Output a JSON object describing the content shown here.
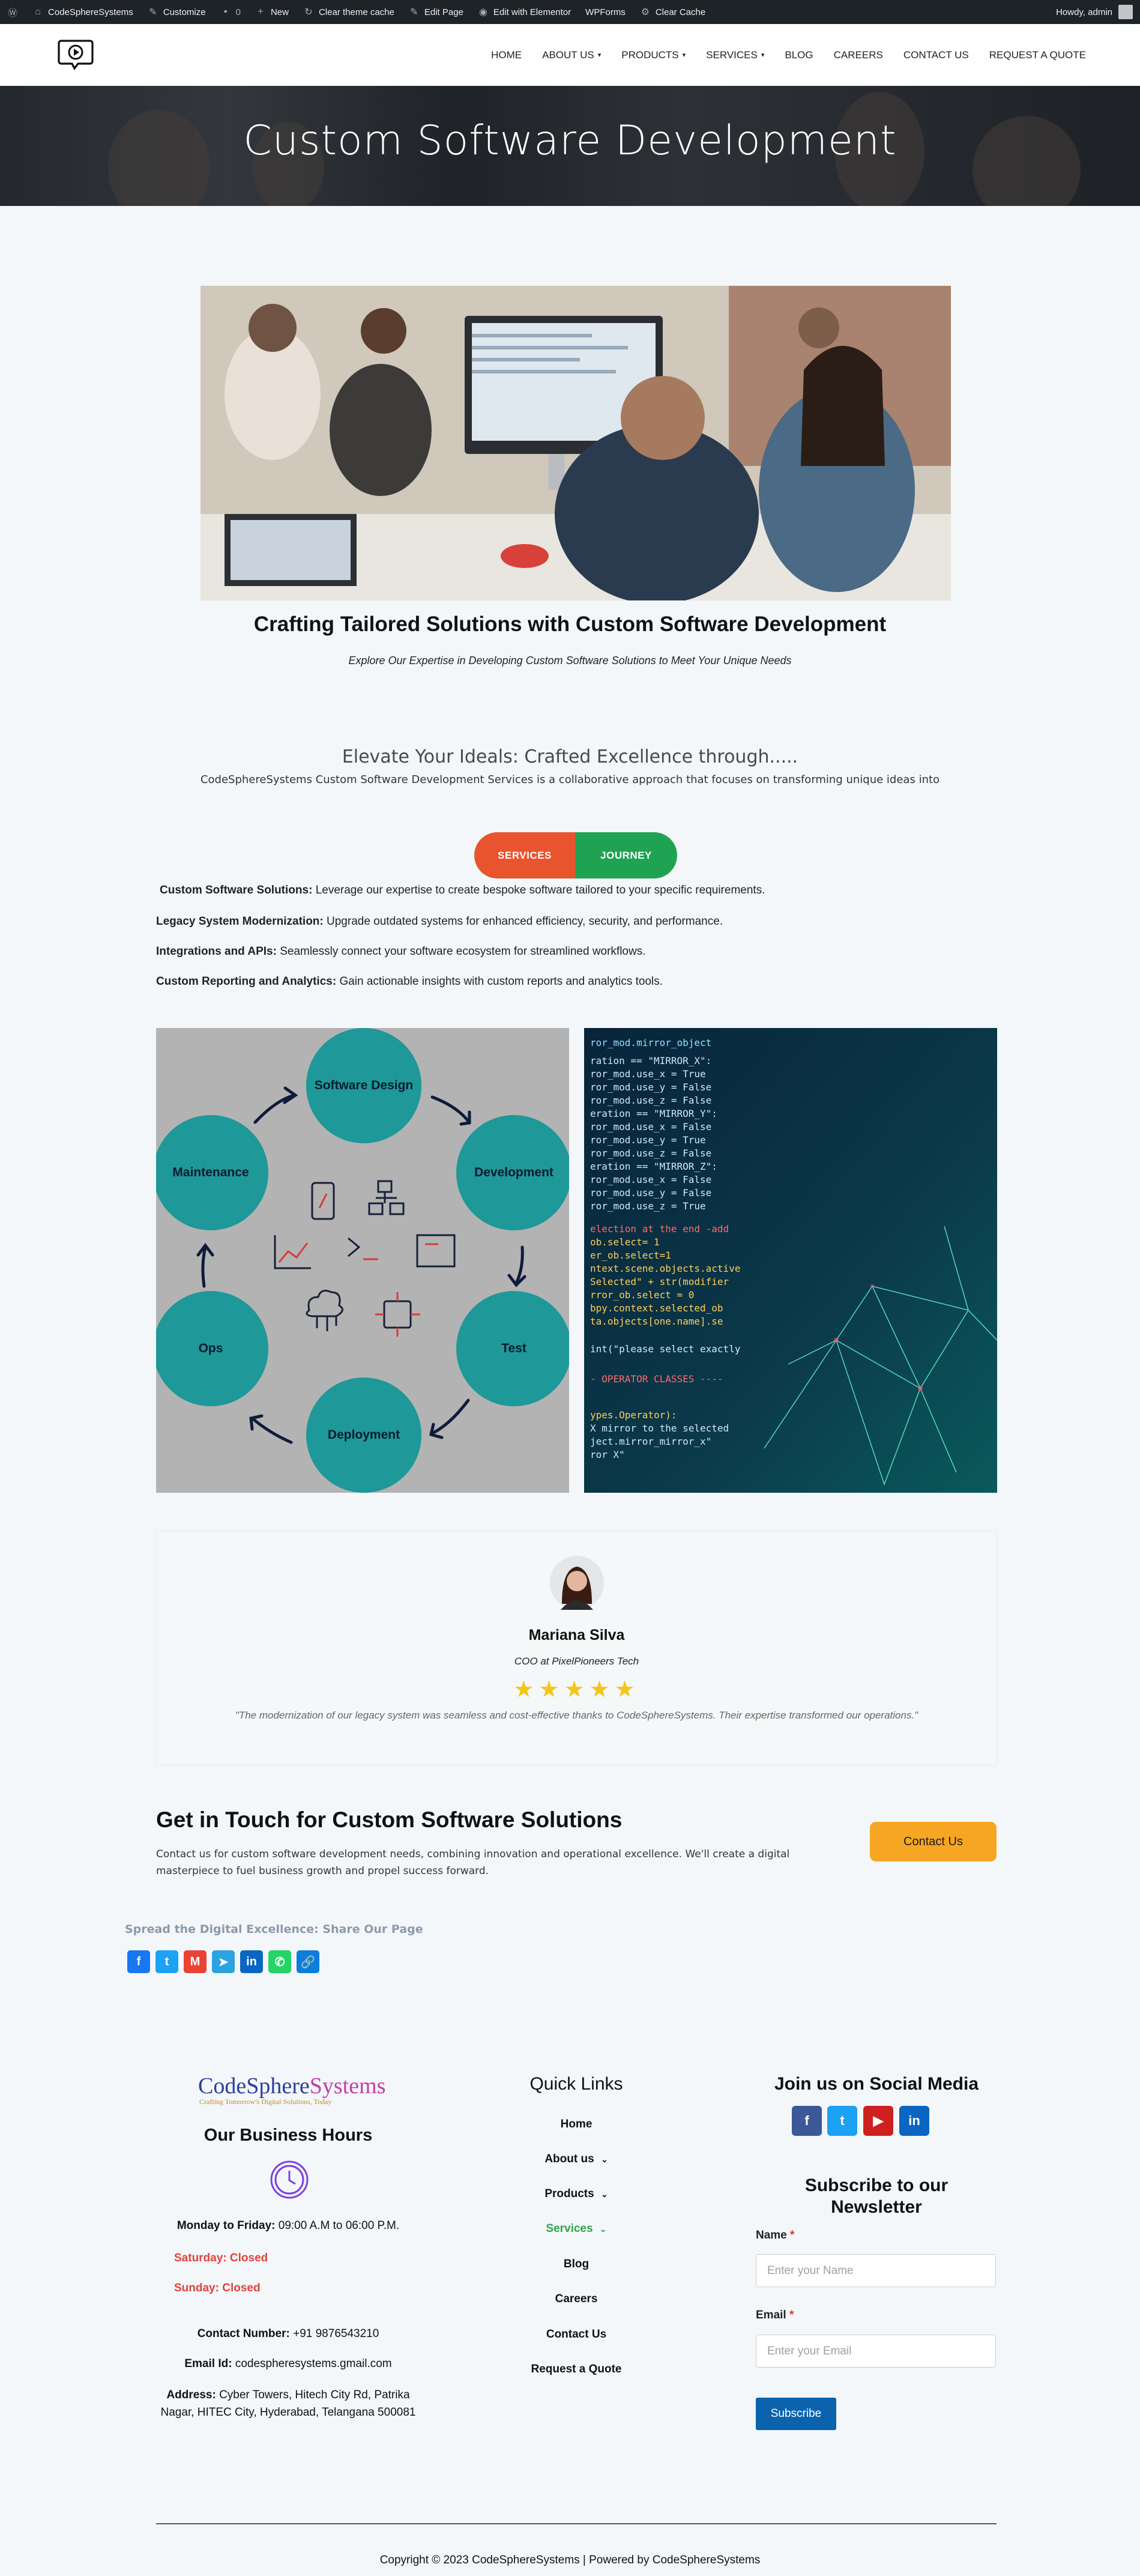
{
  "admin_bar": {
    "site_name": "CodeSphereSystems",
    "customize": "Customize",
    "comments_count": "0",
    "new": "New",
    "clear_theme_cache": "Clear theme cache",
    "edit_page": "Edit Page",
    "edit_elementor": "Edit with Elementor",
    "wpforms": "WPForms",
    "clear_cache": "Clear Cache",
    "howdy": "Howdy, admin"
  },
  "nav": {
    "items": [
      {
        "label": "HOME",
        "dropdown": false
      },
      {
        "label": "ABOUT US",
        "dropdown": true
      },
      {
        "label": "PRODUCTS",
        "dropdown": true
      },
      {
        "label": "SERVICES",
        "dropdown": true
      },
      {
        "label": "BLOG",
        "dropdown": false
      },
      {
        "label": "CAREERS",
        "dropdown": false
      },
      {
        "label": "CONTACT US",
        "dropdown": false
      },
      {
        "label": "REQUEST A QUOTE",
        "dropdown": false
      }
    ]
  },
  "hero": {
    "title": "Custom Software Development"
  },
  "intro": {
    "heading": "Crafting Tailored Solutions with Custom Software Development",
    "subheading": "Explore Our Expertise in Developing Custom Software Solutions to Meet Your Unique Needs"
  },
  "elevate": {
    "heading": "Elevate Your Ideals: Crafted Excellence through.....",
    "text": "CodeSphereSystems Custom Software Development Services is a collaborative approach that focuses on transforming unique ideas into"
  },
  "toggle": {
    "left": "SERVICES",
    "right": "JOURNEY"
  },
  "features": [
    {
      "title": "Custom Software Solutions:",
      "text": "Leverage our expertise to create bespoke software tailored to your specific requirements."
    },
    {
      "title": "Legacy System Modernization:",
      "text": "Upgrade outdated systems for enhanced efficiency, security, and performance."
    },
    {
      "title": "Integrations and APIs:",
      "text": "Seamlessly connect your software ecosystem for streamlined workflows."
    },
    {
      "title": "Custom Reporting and Analytics:",
      "text": "Gain actionable insights with custom reports and analytics tools."
    }
  ],
  "cycle": {
    "nodes": {
      "design": "Software Design",
      "development": "Development",
      "test": "Test",
      "deployment": "Deployment",
      "ops": "Ops",
      "maintenance": "Maintenance"
    }
  },
  "testimonial": {
    "name": "Mariana Silva",
    "role": "COO at PixelPioneers Tech",
    "rating": 5,
    "stars": "★★★★★",
    "quote": "\"The modernization of our legacy system was seamless and cost-effective thanks to CodeSphereSystems. Their expertise transformed our operations.\""
  },
  "contact": {
    "heading": "Get in Touch for Custom Software Solutions",
    "text_line1": "Contact us for custom software development needs, combining innovation and operational excellence. We'll create a digital",
    "text_line2": "masterpiece to fuel business growth and propel success forward.",
    "button": "Contact Us"
  },
  "share": {
    "heading": "Spread the Digital Excellence: Share Our Page"
  },
  "footer": {
    "logo_main": "CodeSphere",
    "logo_accent": "Systems",
    "logo_tagline": "Crafting Tomorrow's Digital Solutions, Today",
    "hours_heading": "Our Business Hours",
    "weekdays_label": "Monday to Friday:",
    "weekdays_value": "09:00 A.M to 06:00 P.M.",
    "saturday": "Saturday: Closed",
    "sunday": "Sunday: Closed",
    "contact_label": "Contact Number:",
    "contact_value": "+91 9876543210",
    "email_label": "Email Id:",
    "email_value": "codespheresystems.gmail.com",
    "address_label": "Address:",
    "address_line1": "Cyber Towers, Hitech City Rd, Patrika",
    "address_line2": "Nagar, HITEC City, Hyderabad, Telangana 500081",
    "quick_links_heading": "Quick Links",
    "quick_links": [
      "Home",
      "About us",
      "Products",
      "Services",
      "Blog",
      "Careers",
      "Contact Us",
      "Request a Quote"
    ],
    "social_heading": "Join us on Social Media",
    "newsletter_heading_line1": "Subscribe to our",
    "newsletter_heading_line2": "Newsletter",
    "name_label": "Name",
    "name_placeholder": "Enter your Name",
    "email_field_label": "Email",
    "email_placeholder": "Enter your Email",
    "required_mark": "*",
    "subscribe": "Subscribe",
    "copyright": "Copyright © 2023 CodeSphereSystems | Powered by CodeSphereSystems"
  },
  "colors": {
    "admin_bar": "#1d2327",
    "services_pill": "#e8542d",
    "journey_pill": "#1fa353",
    "cycle_node": "#1e9898",
    "contact_button": "#f6a623",
    "star": "#f5c518",
    "active_link": "#2ea44f",
    "closed_red": "#e2423b",
    "subscribe": "#0b63ae"
  }
}
